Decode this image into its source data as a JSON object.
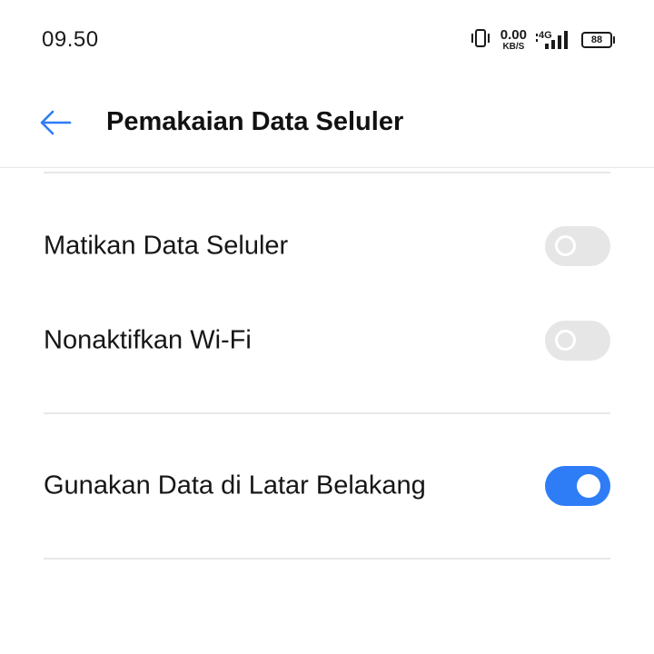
{
  "status_bar": {
    "time": "09.50",
    "speed_value": "0.00",
    "speed_unit": "KB/S",
    "network": "4G",
    "battery": "88",
    "icons": [
      "vibrate-icon",
      "signal-icon",
      "battery-icon"
    ]
  },
  "appbar": {
    "title": "Pemakaian Data Seluler",
    "back_icon": "arrow-left-icon"
  },
  "settings": [
    {
      "label": "Matikan Data Seluler",
      "enabled": false
    },
    {
      "label": "Nonaktifkan Wi-Fi",
      "enabled": false
    },
    {
      "label": "Gunakan Data di Latar Belakang",
      "enabled": true
    }
  ],
  "colors": {
    "accent": "#2e7df7",
    "switch_off": "#e6e6e6",
    "divider": "#e8e8e8"
  }
}
